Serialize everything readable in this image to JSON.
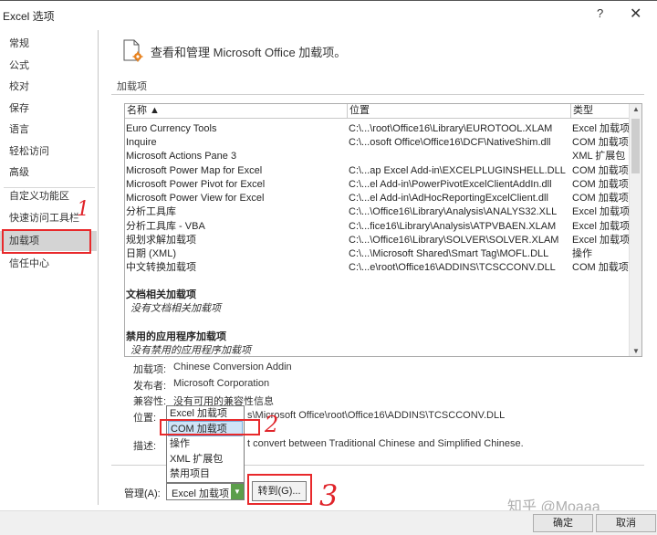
{
  "window": {
    "title": "Excel 选项",
    "help": "?",
    "close": "✕"
  },
  "nav": {
    "items": [
      "常规",
      "公式",
      "校对",
      "保存",
      "语言",
      "轻松访问",
      "高级",
      "自定义功能区",
      "快速访问工具栏",
      "加载项",
      "信任中心"
    ],
    "selected_index": 9
  },
  "header": {
    "text": "查看和管理 Microsoft Office 加载项。",
    "icon": "addin-gear-icon"
  },
  "section_title": "加载项",
  "table": {
    "columns": [
      "名称 ▲",
      "位置",
      "类型"
    ],
    "rows": [
      [
        "Euro Currency Tools",
        "C:\\...\\root\\Office16\\Library\\EUROTOOL.XLAM",
        "Excel 加载项"
      ],
      [
        "Inquire",
        "C:\\...osoft Office\\Office16\\DCF\\NativeShim.dll",
        "COM 加载项"
      ],
      [
        "Microsoft Actions Pane 3",
        "",
        "XML 扩展包"
      ],
      [
        "Microsoft Power Map for Excel",
        "C:\\...ap Excel Add-in\\EXCELPLUGINSHELL.DLL",
        "COM 加载项"
      ],
      [
        "Microsoft Power Pivot for Excel",
        "C:\\...el Add-in\\PowerPivotExcelClientAddIn.dll",
        "COM 加载项"
      ],
      [
        "Microsoft Power View for Excel",
        "C:\\...el Add-in\\AdHocReportingExcelClient.dll",
        "COM 加载项"
      ],
      [
        "分析工具库",
        "C:\\...\\Office16\\Library\\Analysis\\ANALYS32.XLL",
        "Excel 加载项"
      ],
      [
        "分析工具库 - VBA",
        "C:\\...fice16\\Library\\Analysis\\ATPVBAEN.XLAM",
        "Excel 加载项"
      ],
      [
        "规划求解加载项",
        "C:\\...\\Office16\\Library\\SOLVER\\SOLVER.XLAM",
        "Excel 加载项"
      ],
      [
        "日期 (XML)",
        "C:\\...\\Microsoft Shared\\Smart Tag\\MOFL.DLL",
        "操作"
      ],
      [
        "中文转换加载项",
        "C:\\...e\\root\\Office16\\ADDINS\\TCSCCONV.DLL",
        "COM 加载项"
      ]
    ],
    "groups": [
      {
        "title": "文档相关加载项",
        "empty": "没有文档相关加载项"
      },
      {
        "title": "禁用的应用程序加载项",
        "empty": "没有禁用的应用程序加载项"
      }
    ]
  },
  "details": {
    "addin_label": "加载项:",
    "addin_value": "Chinese Conversion Addin",
    "publisher_label": "发布者:",
    "publisher_value": "Microsoft Corporation",
    "compat_label": "兼容性:",
    "compat_value": "没有可用的兼容性信息",
    "location_label": "位置:",
    "location_value": "s\\Microsoft Office\\root\\Office16\\ADDINS\\TCSCCONV.DLL",
    "desc_label": "描述:",
    "desc_value": "t convert between Traditional Chinese and Simplified Chinese."
  },
  "manage": {
    "label": "管理(A):",
    "selected": "Excel 加载项",
    "options": [
      "Excel 加载项",
      "COM 加载项",
      "操作",
      "XML 扩展包",
      "禁用项目"
    ],
    "highlighted_index": 1,
    "goto": "转到(G)..."
  },
  "annotations": [
    "1",
    "2",
    "3"
  ],
  "buttons": {
    "ok": "确定",
    "cancel": "取消"
  },
  "watermark": "知乎 @Moaaa",
  "colors": {
    "highlight": "#e8292b",
    "selected_nav": "#d4d4d4",
    "combo_button": "#5b9e4a"
  }
}
